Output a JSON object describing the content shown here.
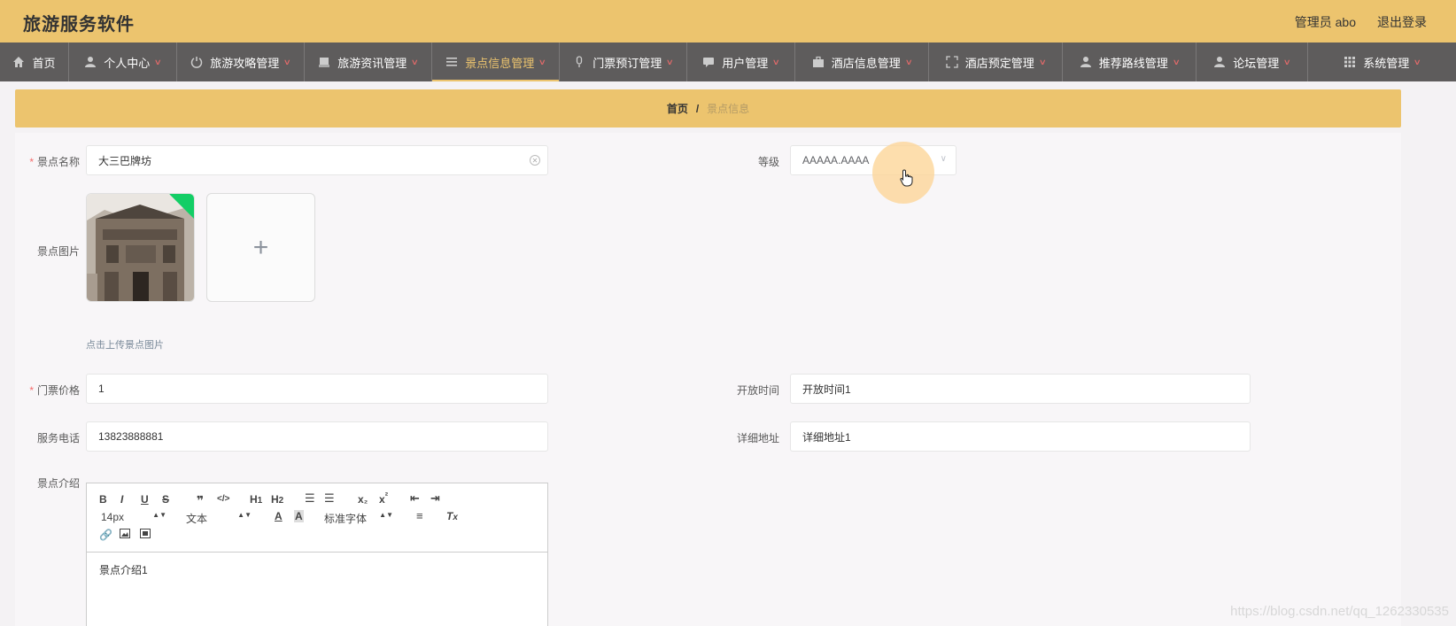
{
  "header": {
    "title": "旅游服务软件",
    "admin": "管理员 abo",
    "logout": "退出登录"
  },
  "nav": [
    {
      "label": "首页",
      "icon": "home-icon"
    },
    {
      "label": "个人中心",
      "icon": "person-icon"
    },
    {
      "label": "旅游攻略管理",
      "icon": "power-icon"
    },
    {
      "label": "旅游资讯管理",
      "icon": "tray-icon"
    },
    {
      "label": "景点信息管理",
      "icon": "list-icon"
    },
    {
      "label": "门票预订管理",
      "icon": "microphone-icon"
    },
    {
      "label": "用户管理",
      "icon": "chat-icon"
    },
    {
      "label": "酒店信息管理",
      "icon": "briefcase-icon"
    },
    {
      "label": "酒店预定管理",
      "icon": "expand-icon"
    },
    {
      "label": "推荐路线管理",
      "icon": "person-icon"
    },
    {
      "label": "论坛管理",
      "icon": "person-icon"
    },
    {
      "label": "系统管理",
      "icon": "grid-icon"
    }
  ],
  "breadcrumb": {
    "home": "首页",
    "separator": "/",
    "current": "景点信息"
  },
  "form": {
    "name_label": "景点名称",
    "name_value": "大三巴牌坊",
    "level_label": "等级",
    "level_value": "AAAAA.AAAA",
    "image_label": "景点图片",
    "upload_hint": "点击上传景点图片",
    "price_label": "门票价格",
    "price_value": "1",
    "open_label": "开放时间",
    "open_value": "开放时间1",
    "phone_label": "服务电话",
    "phone_value": "13823888881",
    "address_label": "详细地址",
    "address_value": "详细地址1",
    "intro_label": "景点介绍",
    "required_mark": "*"
  },
  "editor": {
    "font_size": "14px",
    "block_type": "文本",
    "font_family": "标准字体",
    "content": "景点介绍1"
  },
  "watermark": "https://blog.csdn.net/qq_1262330535",
  "colors": {
    "accent": "#ecc46e",
    "nav_bg": "#5e5c5c",
    "required": "#f56c6c",
    "success": "#13ce66"
  }
}
